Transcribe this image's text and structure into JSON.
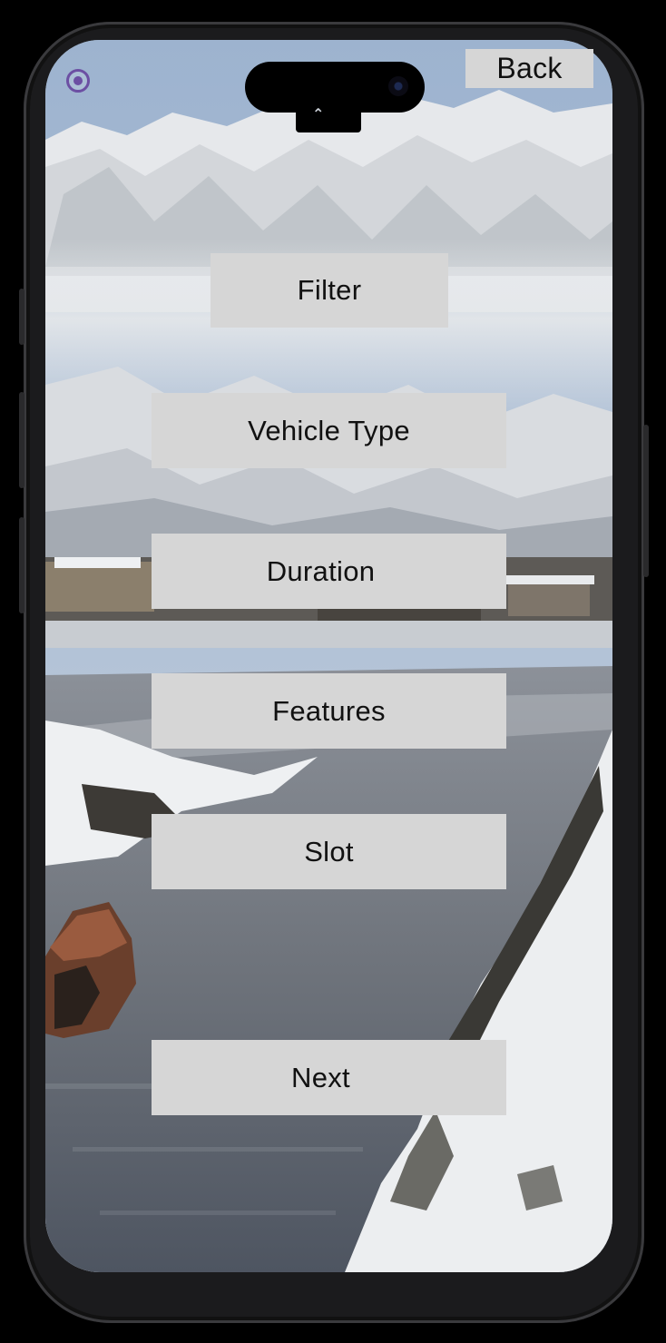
{
  "header": {
    "back_label": "Back",
    "tab_indicator": "⌃",
    "radio_icon": "radio-selected-icon"
  },
  "menu": {
    "filter_label": "Filter",
    "vehicle_type_label": "Vehicle Type",
    "duration_label": "Duration",
    "features_label": "Features",
    "slot_label": "Slot"
  },
  "footer": {
    "next_label": "Next"
  },
  "colors": {
    "button_bg": "#d6d6d6",
    "accent": "#6c4fa3",
    "frame": "#1b1b1d"
  }
}
